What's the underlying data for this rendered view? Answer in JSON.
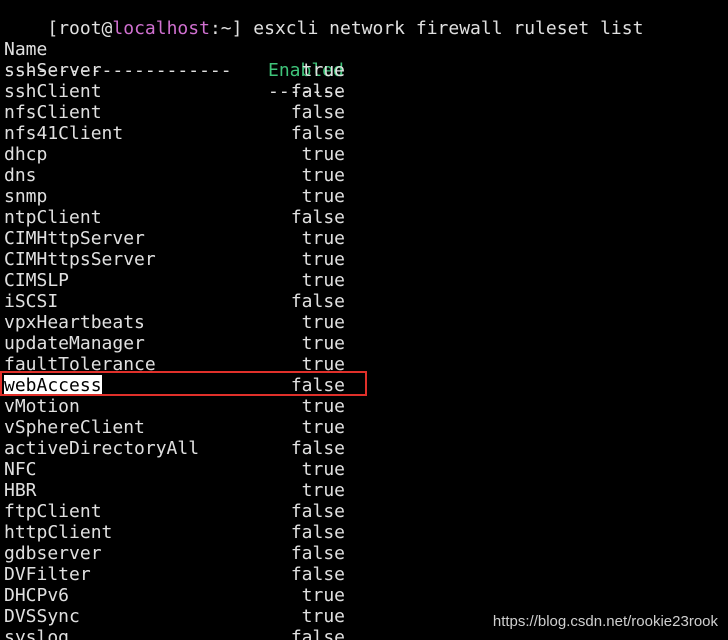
{
  "prompt": {
    "open": "[root@",
    "host": "localhost",
    "rest": ":~] ",
    "command": "esxcli network firewall ruleset list"
  },
  "header": {
    "name": "Name",
    "enabled": "Enabled",
    "name_dashes": "---------------------",
    "enabled_dashes": "-------"
  },
  "rows": [
    {
      "name": "sshServer",
      "enabled": "true"
    },
    {
      "name": "sshClient",
      "enabled": "false"
    },
    {
      "name": "nfsClient",
      "enabled": "false"
    },
    {
      "name": "nfs41Client",
      "enabled": "false"
    },
    {
      "name": "dhcp",
      "enabled": "true"
    },
    {
      "name": "dns",
      "enabled": "true"
    },
    {
      "name": "snmp",
      "enabled": "true"
    },
    {
      "name": "ntpClient",
      "enabled": "false"
    },
    {
      "name": "CIMHttpServer",
      "enabled": "true"
    },
    {
      "name": "CIMHttpsServer",
      "enabled": "true"
    },
    {
      "name": "CIMSLP",
      "enabled": "true"
    },
    {
      "name": "iSCSI",
      "enabled": "false"
    },
    {
      "name": "vpxHeartbeats",
      "enabled": "true"
    },
    {
      "name": "updateManager",
      "enabled": "true"
    },
    {
      "name": "faultTolerance",
      "enabled": "true"
    },
    {
      "name": "webAccess",
      "enabled": "false"
    },
    {
      "name": "vMotion",
      "enabled": "true"
    },
    {
      "name": "vSphereClient",
      "enabled": "true"
    },
    {
      "name": "activeDirectoryAll",
      "enabled": "false"
    },
    {
      "name": "NFC",
      "enabled": "true"
    },
    {
      "name": "HBR",
      "enabled": "true"
    },
    {
      "name": "ftpClient",
      "enabled": "false"
    },
    {
      "name": "httpClient",
      "enabled": "false"
    },
    {
      "name": "gdbserver",
      "enabled": "false"
    },
    {
      "name": "DVFilter",
      "enabled": "false"
    },
    {
      "name": "DHCPv6",
      "enabled": "true"
    },
    {
      "name": "DVSSync",
      "enabled": "true"
    },
    {
      "name": "syslog",
      "enabled": "false"
    }
  ],
  "watermark": "https://blog.csdn.net/rookie23rook",
  "colors": {
    "background": "#000000",
    "text": "#e0e0e0",
    "host": "#d070d0",
    "enabled_header": "#3fc47a",
    "highlight_border": "#e0302a"
  }
}
